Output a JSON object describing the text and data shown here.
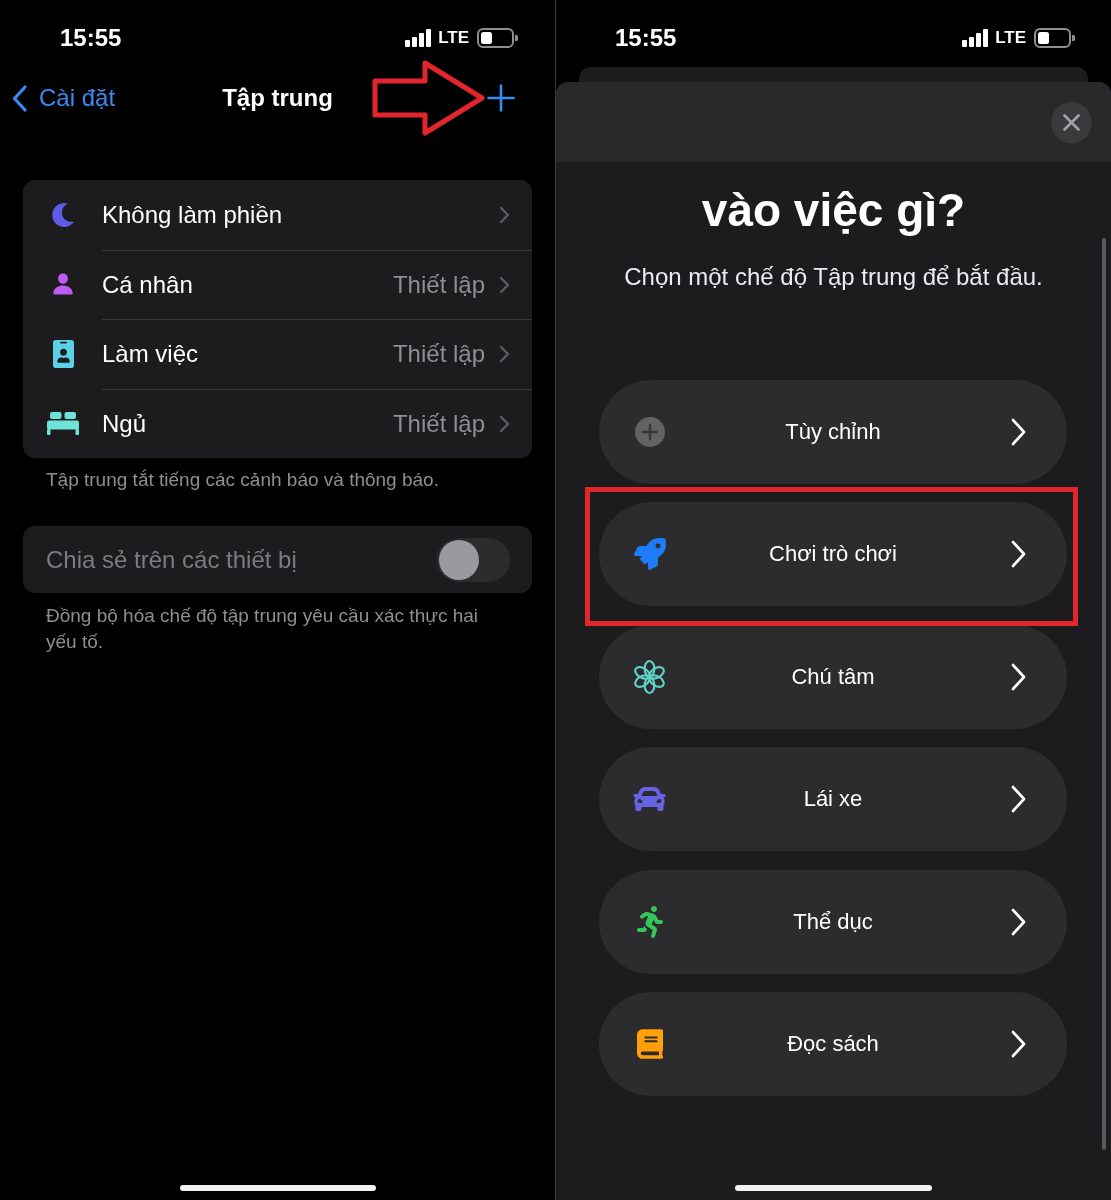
{
  "left_screen": {
    "status_bar": {
      "time": "15:55",
      "network": "LTE"
    },
    "nav_bar": {
      "back_label": "Cài đặt",
      "title": "Tập trung",
      "add_button": {
        "marked_by_arrow": true
      }
    },
    "focus_modes": [
      {
        "label": "Không làm phiền"
      },
      {
        "label": "Cá nhân",
        "value": "Thiết lập"
      },
      {
        "label": "Làm việc",
        "value": "Thiết lập"
      },
      {
        "label": "Ngủ",
        "value": "Thiết lập"
      }
    ],
    "focus_note": "Tập trung tắt tiếng các cảnh báo và thông báo.",
    "share_setting": {
      "label": "Chia sẻ trên các thiết bị",
      "on": false,
      "disabled": true
    },
    "share_note": "Đồng bộ hóa chế độ tập trung yêu cầu xác thực hai yếu tố."
  },
  "right_screen": {
    "status_bar": {
      "time": "15:55",
      "network": "LTE"
    },
    "sheet": {
      "title": "vào việc gì?",
      "subtitle": "Chọn một chế độ Tập trung để bắt đầu.",
      "options": [
        {
          "label": "Tùy chỉnh",
          "highlighted": false
        },
        {
          "label": "Chơi trò chơi",
          "highlighted": true
        },
        {
          "label": "Chú tâm",
          "highlighted": false
        },
        {
          "label": "Lái xe",
          "highlighted": false
        },
        {
          "label": "Thể dục",
          "highlighted": false
        },
        {
          "label": "Đọc sách",
          "highlighted": false
        }
      ]
    }
  }
}
